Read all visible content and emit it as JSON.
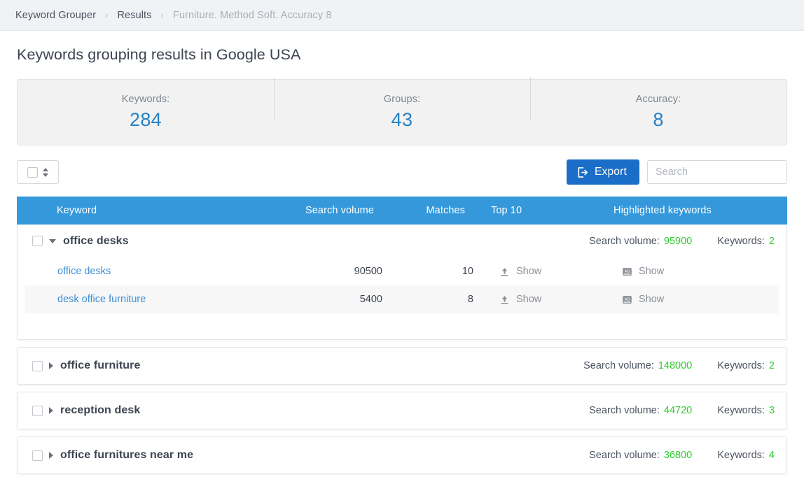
{
  "breadcrumb": {
    "separator": "›",
    "items": [
      {
        "label": "Keyword Grouper",
        "current": false
      },
      {
        "label": "Results",
        "current": false
      },
      {
        "label": "Furniture. Method Soft. Accuracy 8",
        "current": true
      }
    ]
  },
  "page": {
    "title": "Keywords grouping results in Google USA"
  },
  "stats": [
    {
      "label": "Keywords:",
      "value": "284",
      "name": "keywords"
    },
    {
      "label": "Groups:",
      "value": "43",
      "name": "groups"
    },
    {
      "label": "Accuracy:",
      "value": "8",
      "name": "accuracy"
    }
  ],
  "toolbar": {
    "select_all_name": "select-all-dropdown",
    "export_label": "Export",
    "export_icon": "export-icon",
    "search_placeholder": "Search",
    "search_value": ""
  },
  "table": {
    "columns": [
      {
        "label": "Keyword",
        "key": "keyword"
      },
      {
        "label": "Search volume",
        "key": "volume"
      },
      {
        "label": "Matches",
        "key": "matches"
      },
      {
        "label": "Top 10",
        "key": "top10"
      },
      {
        "label": "Highlighted keywords",
        "key": "highlighted"
      }
    ],
    "meta_labels": {
      "volume": "Search volume:",
      "keywords": "Keywords:"
    },
    "show_label": "Show",
    "top10_icon": "upload-arrow-icon",
    "highlighted_icon": "ab-text-icon"
  },
  "groups": [
    {
      "name": "office desks",
      "expanded": true,
      "search_volume": "95900",
      "keywords_count": "2",
      "rows": [
        {
          "keyword": "office desks",
          "volume": "90500",
          "matches": "10",
          "top10": "Show",
          "highlighted": "Show"
        },
        {
          "keyword": "desk office furniture",
          "volume": "5400",
          "matches": "8",
          "top10": "Show",
          "highlighted": "Show"
        }
      ]
    },
    {
      "name": "office furniture",
      "expanded": false,
      "search_volume": "148000",
      "keywords_count": "2",
      "rows": []
    },
    {
      "name": "reception desk",
      "expanded": false,
      "search_volume": "44720",
      "keywords_count": "3",
      "rows": []
    },
    {
      "name": "office furnitures near me",
      "expanded": false,
      "search_volume": "36800",
      "keywords_count": "4",
      "rows": []
    }
  ],
  "colors": {
    "header_blue": "#3498db",
    "export_blue": "#1b6ec8",
    "stat_blue": "#2580c3",
    "green": "#2ecc2e",
    "panel_gray": "#f2f2f2"
  }
}
